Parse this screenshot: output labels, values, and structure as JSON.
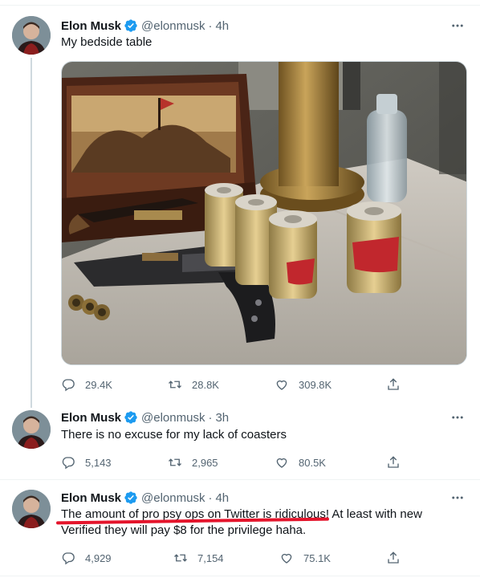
{
  "tweets": [
    {
      "author": "Elon Musk",
      "handle": "@elonmusk",
      "separator": "·",
      "time": "4h",
      "text": "My bedside table",
      "has_media": true,
      "replies": "29.4K",
      "retweets": "28.8K",
      "likes": "309.8K"
    },
    {
      "author": "Elon Musk",
      "handle": "@elonmusk",
      "separator": "·",
      "time": "3h",
      "text": "There is no excuse for my lack of coasters",
      "replies": "5,143",
      "retweets": "2,965",
      "likes": "80.5K"
    },
    {
      "author": "Elon Musk",
      "handle": "@elonmusk",
      "separator": "·",
      "time": "4h",
      "text_line1": "The amount of pro psy ops on Twitter is ridiculous! At least with new",
      "text_line2": "Verified they will pay $8 for the privilege haha.",
      "replies": "4,929",
      "retweets": "7,154",
      "likes": "75.1K"
    }
  ],
  "colors": {
    "verified_blue": "#1d9bf0",
    "secondary_text": "#536471",
    "underline_red": "#e4142b"
  },
  "icons": [
    "verified-badge-icon",
    "more-icon",
    "reply-icon",
    "retweet-icon",
    "like-icon",
    "share-icon"
  ]
}
